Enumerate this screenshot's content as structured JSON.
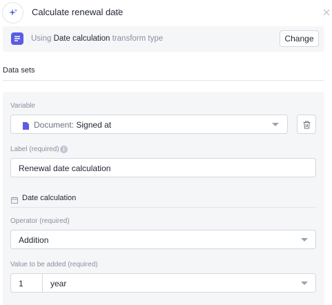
{
  "header": {
    "title": "Calculate renewal date",
    "icons": {
      "sparkle": "sparkle-icon",
      "edit": "pencil-icon",
      "close": "close-icon"
    }
  },
  "transform": {
    "prefix": "Using",
    "type_name": "Date calculation",
    "suffix": "transform type",
    "change_label": "Change",
    "badge_color": "#5b5ce2"
  },
  "section": {
    "title": "Data sets"
  },
  "variable": {
    "label": "Variable",
    "source_prefix": "Document:",
    "source_value": "Signed at"
  },
  "label_field": {
    "label": "Label",
    "required_note": "(required)",
    "value": "Renewal date calculation"
  },
  "date_calc": {
    "title": "Date calculation"
  },
  "operator": {
    "label": "Operator",
    "required_note": "(required)",
    "value": "Addition"
  },
  "value_added": {
    "label": "Value to be added",
    "required_note": "(required)",
    "amount": "1",
    "unit": "year"
  }
}
